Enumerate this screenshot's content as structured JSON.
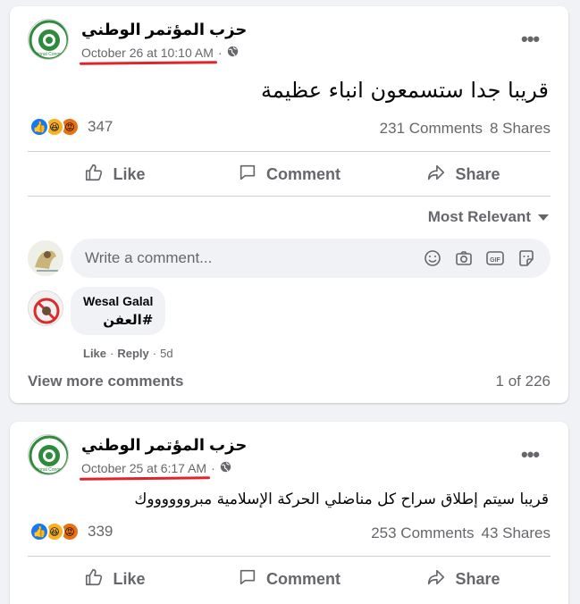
{
  "posts": [
    {
      "page_name": "حزب المؤتمر الوطني",
      "timestamp": "October 26 at 10:10 AM",
      "separator": "·",
      "privacy_icon": "globe-icon",
      "more_label": "•••",
      "text": "قريبا جدا ستسمعون انباء عظيمة",
      "reactions": [
        "like",
        "haha",
        "angry"
      ],
      "reaction_count": "347",
      "comments_count": "231 Comments",
      "shares_count": "8 Shares",
      "actions": {
        "like": "Like",
        "comment": "Comment",
        "share": "Share"
      },
      "sort_label": "Most Relevant",
      "composer_placeholder": "Write a comment...",
      "composer_icons": [
        "emoji-icon",
        "camera-icon",
        "gif-icon",
        "sticker-icon"
      ],
      "comment": {
        "author": "Wesal Galal",
        "text": "#العفن",
        "like": "Like",
        "reply": "Reply",
        "sep": "·",
        "age": "5d"
      },
      "view_more": "View more comments",
      "pager": "1 of 226"
    },
    {
      "page_name": "حزب المؤتمر الوطني",
      "timestamp": "October 25 at 6:17 AM",
      "separator": "·",
      "privacy_icon": "globe-icon",
      "more_label": "•••",
      "text": "قريبا سيتم إطلاق سراح كل مناضلي الحركة الإسلامية مبرووووووك",
      "reactions": [
        "like",
        "haha",
        "angry"
      ],
      "reaction_count": "339",
      "comments_count": "253 Comments",
      "shares_count": "43 Shares",
      "actions": {
        "like": "Like",
        "comment": "Comment",
        "share": "Share"
      }
    }
  ],
  "logo_text": "National Congress",
  "colors": {
    "accent": "#1877f2",
    "underline": "#e0242b",
    "logo_green": "#2e8b3d",
    "muted": "#65676b"
  }
}
